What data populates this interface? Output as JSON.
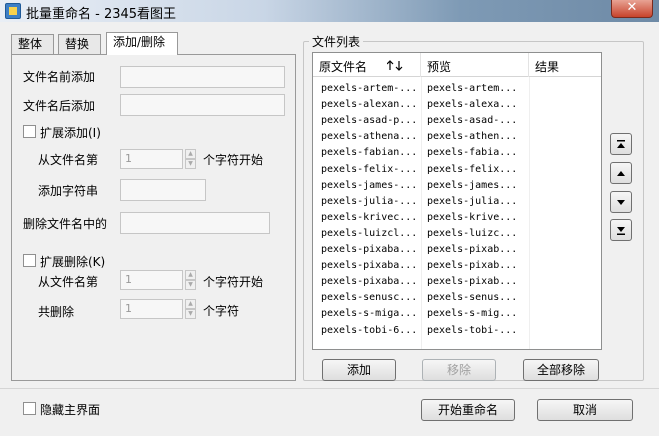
{
  "window": {
    "title": "批量重命名 - 2345看图王",
    "close_label": "✕"
  },
  "tabs": [
    "整体",
    "替换",
    "添加/删除"
  ],
  "add_delete": {
    "prefix_label": "文件名前添加",
    "suffix_label": "文件名后添加",
    "ext_add_label": "扩展添加(I)",
    "ext_add_from_label": "从文件名第",
    "ext_add_from_value": "1",
    "ext_add_unit": "个字符开始",
    "ext_add_string_label": "添加字符串",
    "delete_in_name_label": "删除文件名中的",
    "ext_delete_label": "扩展删除(K)",
    "ext_delete_from_label": "从文件名第",
    "ext_delete_from_value": "1",
    "ext_delete_unit": "个字符开始",
    "ext_delete_count_label": "共删除",
    "ext_delete_count_value": "1",
    "ext_delete_count_unit": "个字符"
  },
  "file_list": {
    "group_title": "文件列表",
    "columns": [
      "原文件名",
      "预览",
      "结果"
    ],
    "sort_icon": "sort-arrows-icon",
    "rows": [
      [
        "pexels-artem-...",
        "pexels-artem..."
      ],
      [
        "pexels-alexan...",
        "pexels-alexa..."
      ],
      [
        "pexels-asad-p...",
        "pexels-asad-..."
      ],
      [
        "pexels-athena...",
        "pexels-athen..."
      ],
      [
        "pexels-fabian...",
        "pexels-fabia..."
      ],
      [
        "pexels-felix-...",
        "pexels-felix..."
      ],
      [
        "pexels-james-...",
        "pexels-james..."
      ],
      [
        "pexels-julia-...",
        "pexels-julia..."
      ],
      [
        "pexels-krivec...",
        "pexels-krive..."
      ],
      [
        "pexels-luizcl...",
        "pexels-luizc..."
      ],
      [
        "pexels-pixaba...",
        "pexels-pixab..."
      ],
      [
        "pexels-pixaba...",
        "pexels-pixab..."
      ],
      [
        "pexels-pixaba...",
        "pexels-pixab..."
      ],
      [
        "pexels-senusc...",
        "pexels-senus..."
      ],
      [
        "pexels-s-miga...",
        "pexels-s-mig..."
      ],
      [
        "pexels-tobi-6...",
        "pexels-tobi-..."
      ]
    ],
    "add_label": "添加",
    "remove_label": "移除",
    "remove_all_label": "全部移除"
  },
  "footer": {
    "hide_main_label": "隐藏主界面",
    "start_label": "开始重命名",
    "cancel_label": "取消"
  }
}
